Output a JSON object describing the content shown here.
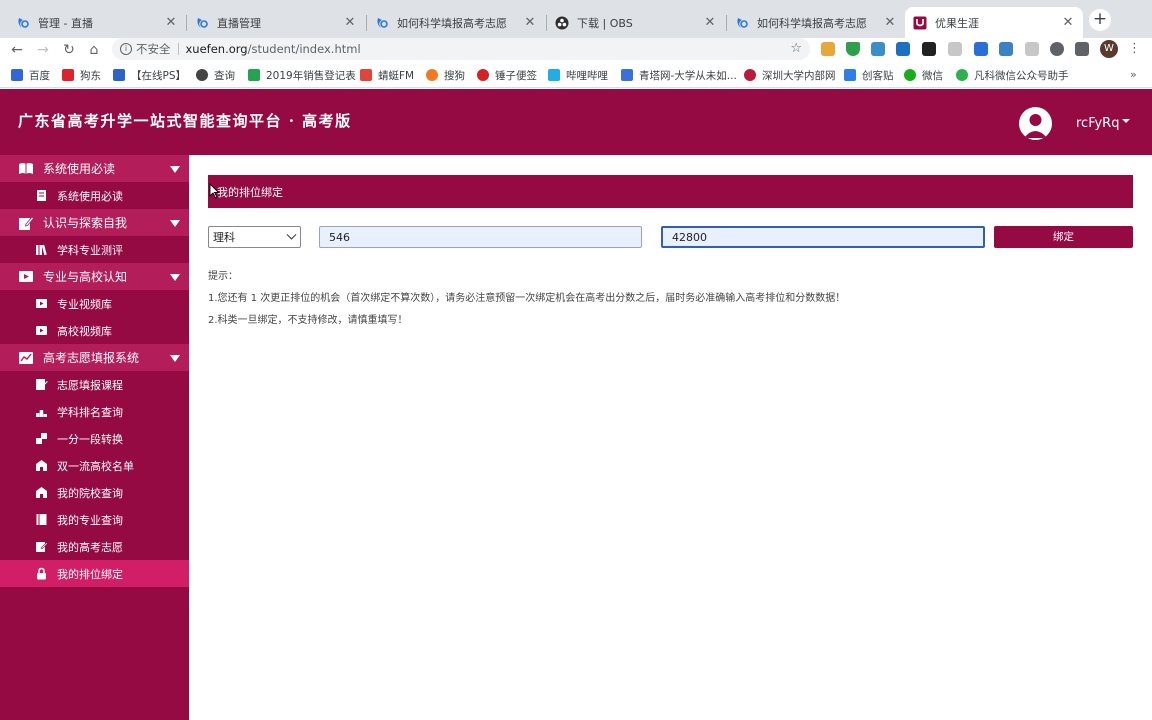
{
  "browser": {
    "tabs": [
      {
        "title": "管理 - 直播",
        "icon": "blue-swirl-icon"
      },
      {
        "title": "直播管理",
        "icon": "blue-swirl-icon"
      },
      {
        "title": "如何科学填报高考志愿",
        "icon": "blue-swirl-icon"
      },
      {
        "title": "下载 | OBS",
        "icon": "obs-icon"
      },
      {
        "title": "如何科学填报高考志愿",
        "icon": "blue-swirl-icon"
      },
      {
        "title": "优果生涯",
        "icon": "youguo-icon",
        "active": true
      }
    ],
    "new_tab": "+",
    "close_glyph": "✕",
    "address": {
      "security_label": "不安全",
      "host": "xuefen.org",
      "path": "/student/index.html"
    },
    "profile_letter": "W",
    "bookmarks": [
      "百度",
      "狗东",
      "【在线PS】",
      "查询",
      "2019年销售登记表",
      "蜻蜓FM",
      "搜狗",
      "锤子便签",
      "哔哩哔哩",
      "青塔网-大学从未如...",
      "深圳大学内部网",
      "创客贴",
      "微信",
      "凡科微信公众号助手"
    ],
    "bookmarks_more": "»"
  },
  "header": {
    "title": "广东省高考升学一站式智能查询平台 · 高考版",
    "username": "rcFyRq"
  },
  "sidebar": {
    "sections": [
      {
        "label": "系统使用必读",
        "icon": "book-icon",
        "items": [
          {
            "label": "系统使用必读",
            "icon": "document-icon"
          }
        ]
      },
      {
        "label": "认识与探索自我",
        "icon": "edit-icon",
        "items": [
          {
            "label": "学科专业测评",
            "icon": "books-icon"
          }
        ]
      },
      {
        "label": "专业与高校认知",
        "icon": "video-icon",
        "items": [
          {
            "label": "专业视频库",
            "icon": "film-icon"
          },
          {
            "label": "高校视频库",
            "icon": "play-icon"
          }
        ]
      },
      {
        "label": "高考志愿填报系统",
        "icon": "chart-icon",
        "items": [
          {
            "label": "志愿填报课程",
            "icon": "course-icon"
          },
          {
            "label": "学科排名查询",
            "icon": "ranking-icon"
          },
          {
            "label": "一分一段转换",
            "icon": "convert-icon"
          },
          {
            "label": "双一流高校名单",
            "icon": "school-icon"
          },
          {
            "label": "我的院校查询",
            "icon": "school-icon"
          },
          {
            "label": "我的专业查询",
            "icon": "book-icon"
          },
          {
            "label": "我的高考志愿",
            "icon": "edit-icon"
          },
          {
            "label": "我的排位绑定",
            "icon": "lock-icon",
            "active": true
          }
        ]
      }
    ]
  },
  "main": {
    "panel_title": "我的排位绑定",
    "subject_select": {
      "value": "理科"
    },
    "score_input": {
      "value": "546"
    },
    "rank_input": {
      "value": "42800"
    },
    "bind_button": "绑定",
    "tips": {
      "heading": "提示：",
      "line1": "1.您还有 1 次更正排位的机会（首次绑定不算次数），请务必注意预留一次绑定机会在高考出分数之后，届时务必准确输入高考排位和分数数据！",
      "line2": "2.科类一旦绑定，不支持修改，请慎重填写！"
    }
  },
  "colors": {
    "brand": "#960a44",
    "sidebar_section": "#b31e5a",
    "sidebar_active": "#d21e66"
  }
}
